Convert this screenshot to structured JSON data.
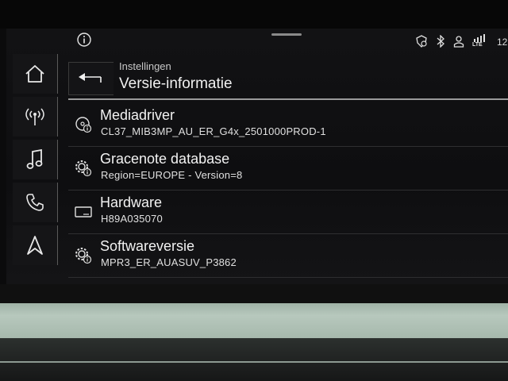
{
  "status_bar": {
    "icons": [
      "info-icon",
      "location-shield-icon",
      "bluetooth-icon",
      "user-icon",
      "lte-signal-icon"
    ],
    "lte_label": "LTE",
    "time": "12"
  },
  "side_nav": {
    "items": [
      {
        "name": "home",
        "icon": "home-icon"
      },
      {
        "name": "radio",
        "icon": "antenna-icon"
      },
      {
        "name": "media",
        "icon": "music-note-icon"
      },
      {
        "name": "phone",
        "icon": "phone-icon"
      },
      {
        "name": "navigation",
        "icon": "navigation-arrow-icon"
      }
    ]
  },
  "header": {
    "breadcrumb": "Instellingen",
    "title": "Versie-informatie"
  },
  "rows": [
    {
      "title": "Mediadriver",
      "value": "CL37_MIB3MP_AU_ER_G4x_2501000PROD-1",
      "icon": "media-disc-info-icon"
    },
    {
      "title": "Gracenote database",
      "value": "Region=EUROPE - Version=8",
      "icon": "gear-info-icon"
    },
    {
      "title": "Hardware",
      "value": "H89A035070",
      "icon": "hardware-unit-icon"
    },
    {
      "title": "Softwareversie",
      "value": "MPR3_ER_AUASUV_P3862",
      "icon": "gear-info-icon"
    }
  ],
  "colors": {
    "screen_bg": "#0e0e10",
    "text": "#f2f2f2",
    "trim": "#b7c8bd"
  }
}
